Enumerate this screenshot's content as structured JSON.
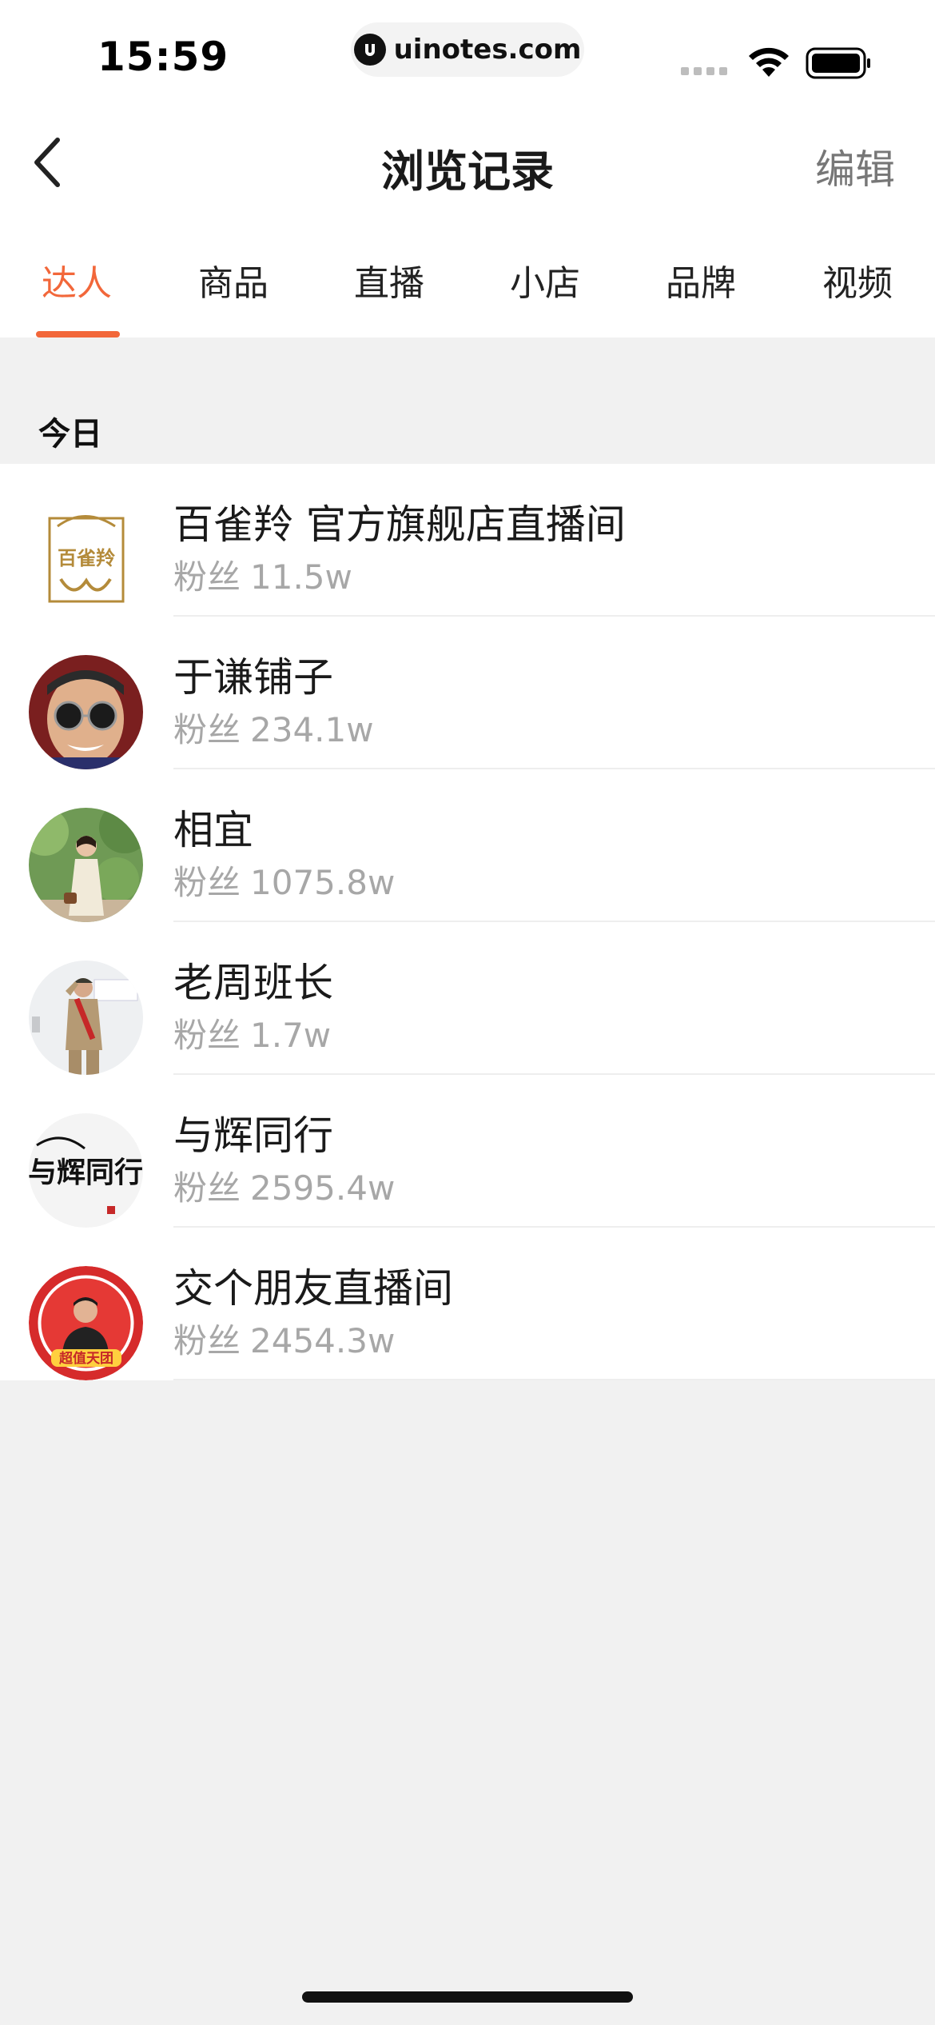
{
  "status_bar": {
    "time": "15:59",
    "url": "uinotes.com",
    "icons": [
      "signal-dots-icon",
      "wifi-icon",
      "battery-icon"
    ]
  },
  "nav": {
    "back_icon": "chevron-left-icon",
    "title": "浏览记录",
    "edit_label": "编辑"
  },
  "tabs": [
    {
      "label": "达人",
      "active": true
    },
    {
      "label": "商品",
      "active": false
    },
    {
      "label": "直播",
      "active": false
    },
    {
      "label": "小店",
      "active": false
    },
    {
      "label": "品牌",
      "active": false
    },
    {
      "label": "视频",
      "active": false
    }
  ],
  "section": {
    "title": "今日"
  },
  "fans_label": "粉丝",
  "items": [
    {
      "name": "百雀羚 官方旗舰店直播间",
      "fans": "11.5w",
      "avatar_logo_text": "百雀羚",
      "avatar": "brand-logo-avatar"
    },
    {
      "name": "于谦铺子",
      "fans": "234.1w",
      "avatar": "man-with-sunglasses-avatar"
    },
    {
      "name": "相宜",
      "fans": "1075.8w",
      "avatar": "woman-in-garden-avatar"
    },
    {
      "name": "老周班长",
      "fans": "1.7w",
      "avatar": "soldier-saluting-avatar"
    },
    {
      "name": "与辉同行",
      "fans": "2595.4w",
      "avatar_logo_text": "与辉同行",
      "avatar": "calligraphy-logo-avatar"
    },
    {
      "name": "交个朋友直播间",
      "fans": "2454.3w",
      "avatar_badge_text": "超值天团",
      "avatar": "man-red-badge-avatar"
    }
  ],
  "colors": {
    "accent": "#f2673a",
    "background": "#f1f1f1",
    "muted_text": "#a7a7a7"
  }
}
